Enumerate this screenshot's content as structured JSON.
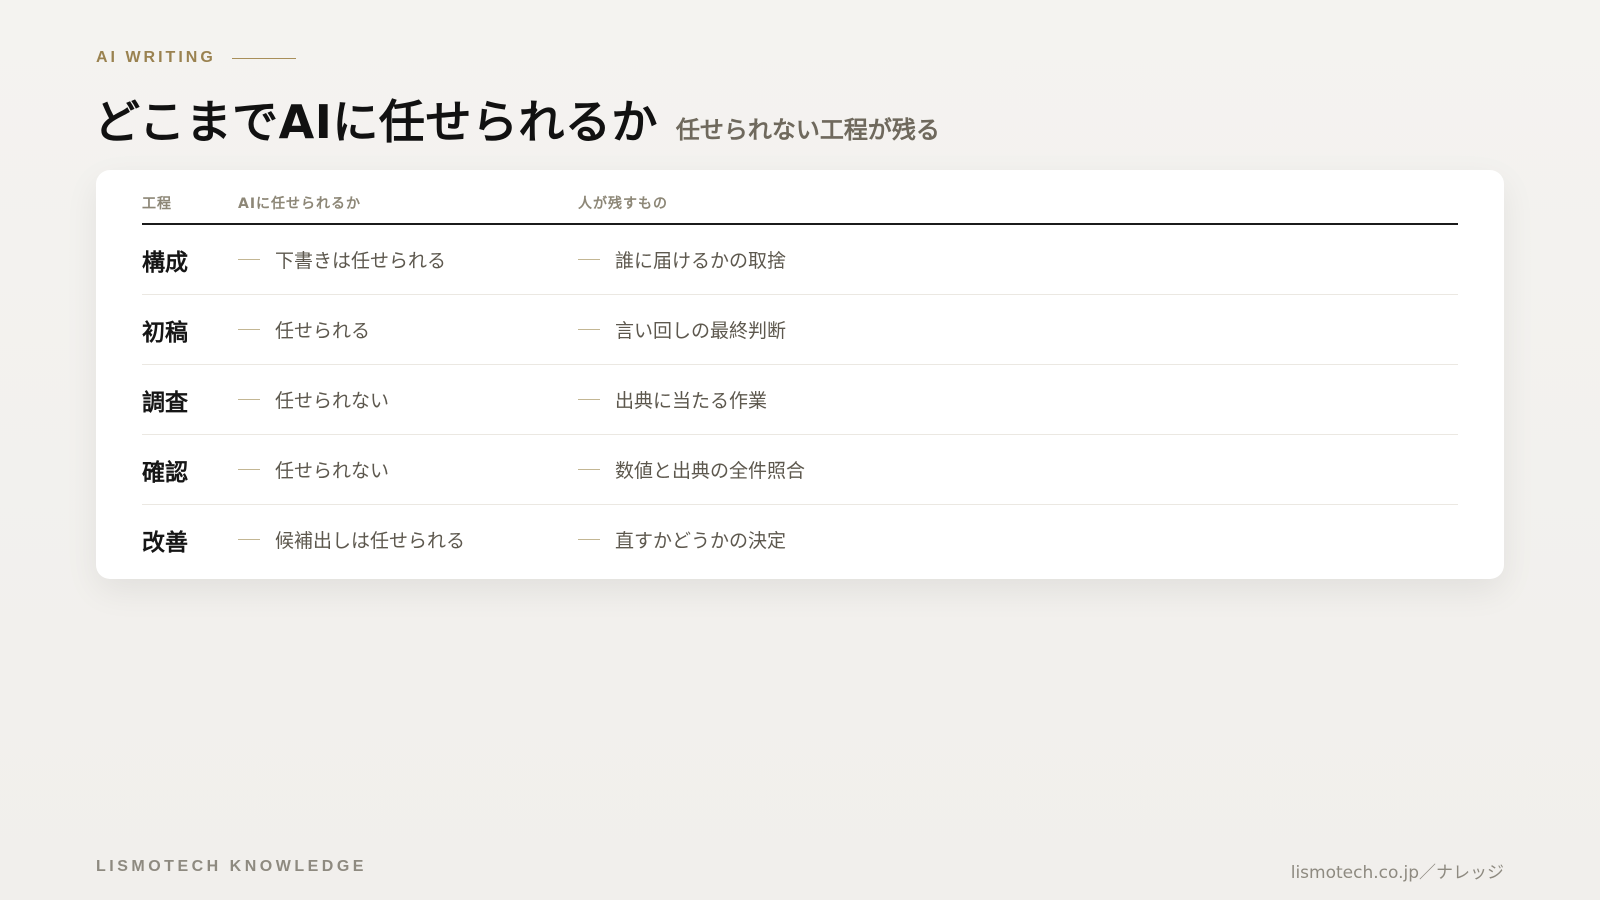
{
  "header": {
    "eyebrow": "AI WRITING",
    "title": "どこまでAIに任せられるか",
    "subtitle": "任せられない工程が残る"
  },
  "table": {
    "columns": [
      "工程",
      "AIに任せられるか",
      "人が残すもの"
    ],
    "rows": [
      {
        "step": "構成",
        "ai": "下書きは任せられる",
        "human": "誰に届けるかの取捨"
      },
      {
        "step": "初稿",
        "ai": "任せられる",
        "human": "言い回しの最終判断"
      },
      {
        "step": "調査",
        "ai": "任せられない",
        "human": "出典に当たる作業"
      },
      {
        "step": "確認",
        "ai": "任せられない",
        "human": "数値と出典の全件照合"
      },
      {
        "step": "改善",
        "ai": "候補出しは任せられる",
        "human": "直すかどうかの決定"
      }
    ]
  },
  "footer": {
    "brand": "LISMOTECH KNOWLEDGE",
    "url": "lismotech.co.jp／ナレッジ"
  }
}
